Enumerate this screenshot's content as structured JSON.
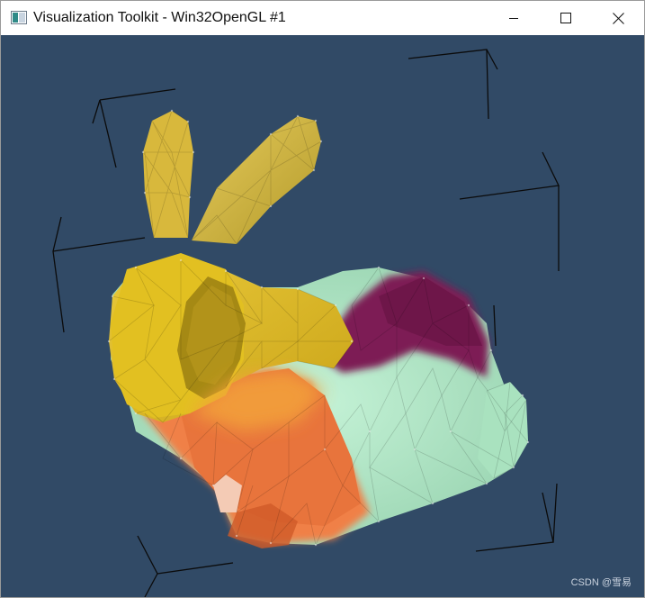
{
  "window": {
    "title": "Visualization Toolkit - Win32OpenGL #1",
    "controls": [
      "minimize-icon",
      "maximize-icon",
      "close-icon"
    ]
  },
  "scene": {
    "background_color": "#314a66",
    "colors": {
      "gold": "#e3c22a",
      "gold_dark": "#a58c14",
      "orange": "#f08046",
      "magenta": "#7d1d55",
      "mint": "#b3e9c8",
      "corner_lines": "#0b0b0b"
    }
  },
  "watermark": "CSDN @雪易"
}
